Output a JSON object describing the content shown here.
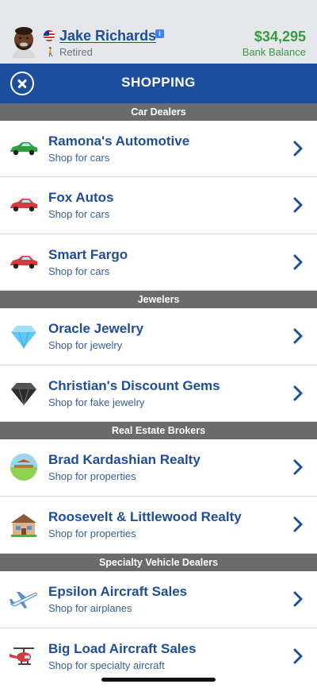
{
  "profile": {
    "name": "Jake Richards",
    "status": "Retired",
    "balance": "$34,295",
    "balance_label": "Bank Balance"
  },
  "titlebar": {
    "title": "SHOPPING"
  },
  "sections": [
    {
      "title": "Car Dealers",
      "items": [
        {
          "title": "Ramona's Automotive",
          "subtitle": "Shop for cars",
          "icon": "green-car-icon"
        },
        {
          "title": "Fox Autos",
          "subtitle": "Shop for cars",
          "icon": "red-car-icon"
        },
        {
          "title": "Smart Fargo",
          "subtitle": "Shop for cars",
          "icon": "red-car-icon"
        }
      ]
    },
    {
      "title": "Jewelers",
      "items": [
        {
          "title": "Oracle Jewelry",
          "subtitle": "Shop for jewelry",
          "icon": "blue-diamond-icon"
        },
        {
          "title": "Christian's Discount Gems",
          "subtitle": "Shop for fake jewelry",
          "icon": "dark-gem-icon"
        }
      ]
    },
    {
      "title": "Real Estate Brokers",
      "items": [
        {
          "title": "Brad Kardashian Realty",
          "subtitle": "Shop for properties",
          "icon": "landscape-icon"
        },
        {
          "title": "Roosevelt & Littlewood Realty",
          "subtitle": "Shop for properties",
          "icon": "house-icon"
        }
      ]
    },
    {
      "title": "Specialty Vehicle Dealers",
      "items": [
        {
          "title": "Epsilon Aircraft Sales",
          "subtitle": "Shop for airplanes",
          "icon": "airplane-icon"
        },
        {
          "title": "Big Load Aircraft Sales",
          "subtitle": "Shop for specialty aircraft",
          "icon": "helicopter-icon"
        }
      ]
    }
  ],
  "colors": {
    "brand_blue": "#1d4e9e",
    "money_green": "#3a9a3f",
    "section_gray": "#6b6b6b"
  }
}
